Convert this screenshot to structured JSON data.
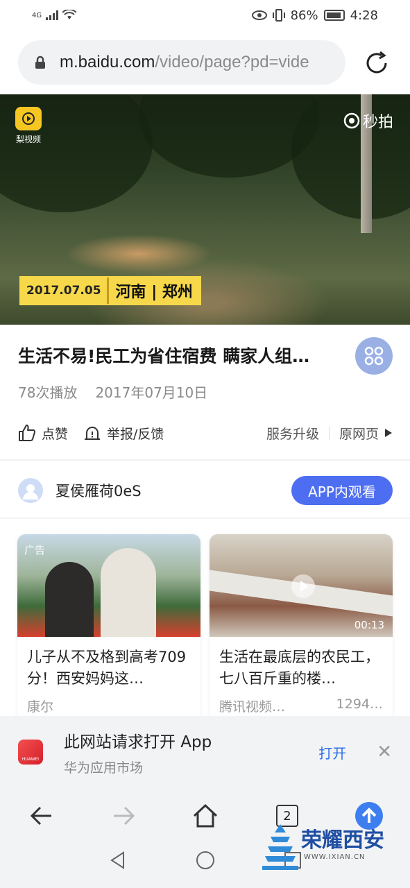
{
  "status_bar": {
    "network": "4G",
    "battery": "86%",
    "time": "4:28"
  },
  "address_bar": {
    "host": "m.baidu.com",
    "path": "/video/page?pd=vide"
  },
  "video": {
    "source_logo_text": "梨视频",
    "watermark": "秒拍",
    "date_tag": "2017.07.05",
    "place_tag": "河南 | 郑州"
  },
  "article": {
    "title": "生活不易!民工为省住宿费 瞒家人组…",
    "plays": "78次播放",
    "date": "2017年07月10日"
  },
  "actions": {
    "like": "点赞",
    "report": "举报/反馈",
    "service": "服务升级",
    "original": "原网页"
  },
  "author": {
    "name": "夏侯雁荷0eS",
    "app_button": "APP内观看"
  },
  "cards": [
    {
      "ad_label": "广告",
      "title": "儿子从不及格到高考709分！西安妈妈这…",
      "source": "康尔",
      "count": ""
    },
    {
      "ad_label": "",
      "title": "生活在最底层的农民工，七八百斤重的楼…",
      "source": "腾讯视频…",
      "count": "1294…",
      "duration": "00:13"
    }
  ],
  "app_prompt": {
    "icon_text": "HUAWEI",
    "title": "此网站请求打开 App",
    "subtitle": "华为应用市场",
    "open": "打开"
  },
  "nav": {
    "tab_count": "2"
  },
  "watermark": {
    "cn": "荣耀西安",
    "en": "WWW.IXIAN.CN"
  },
  "colors": {
    "accent": "#4e6ef2",
    "link": "#2d6ee6",
    "tag": "#f6d84a"
  }
}
